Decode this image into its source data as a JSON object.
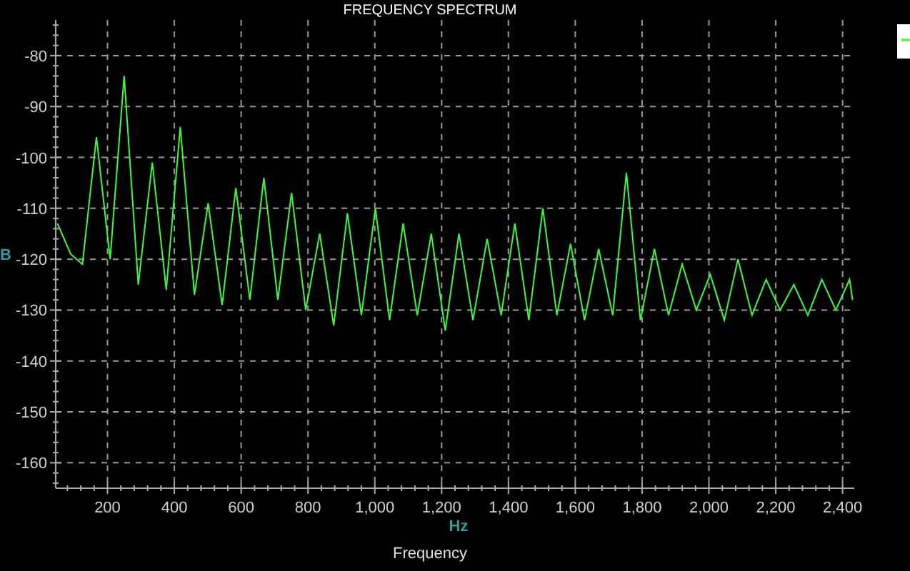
{
  "chart": {
    "chart_data": {
      "type": "line",
      "title": "FREQUENCY SPECTRUM",
      "xlabel": "Hz",
      "ylabel": "B",
      "x": [
        50,
        90,
        125,
        167,
        208,
        250,
        292,
        334,
        376,
        418,
        460,
        501,
        543,
        584,
        626,
        668,
        710,
        751,
        793,
        835,
        877,
        918,
        960,
        1002,
        1044,
        1085,
        1127,
        1169,
        1211,
        1252,
        1294,
        1336,
        1378,
        1419,
        1461,
        1503,
        1545,
        1586,
        1628,
        1670,
        1712,
        1753,
        1795,
        1837,
        1879,
        1920,
        1962,
        2004,
        2046,
        2087,
        2129,
        2171,
        2213,
        2254,
        2296,
        2338,
        2380,
        2421,
        2430
      ],
      "grid": true,
      "series": [
        {
          "color": "#33ff33",
          "values": [
            -113,
            -119,
            -121,
            -96,
            -120,
            -84,
            -125,
            -101,
            -126,
            -94,
            -127,
            -109,
            -129,
            -106,
            -128,
            -104,
            -128,
            -107,
            -130,
            -115,
            -133,
            -111,
            -131,
            -110,
            -132,
            -113,
            -131,
            -115,
            -134,
            -115,
            -132,
            -116,
            -131,
            -113,
            -132,
            -110,
            -131,
            -117,
            -132,
            -118,
            -131,
            -103,
            -132,
            -118,
            -131,
            -121,
            -130,
            -123,
            -132,
            -120,
            -131,
            -124,
            -130,
            -125,
            -131,
            -124,
            -130,
            -124,
            -128
          ]
        }
      ],
      "xlim": [
        45,
        2435
      ],
      "ylim": [
        -165,
        -73
      ],
      "xticks": [
        {
          "value": 200,
          "label": "200"
        },
        {
          "value": 400,
          "label": "400"
        },
        {
          "value": 600,
          "label": "600"
        },
        {
          "value": 800,
          "label": "800"
        },
        {
          "value": 1000,
          "label": "1,000"
        },
        {
          "value": 1200,
          "label": "1,200"
        },
        {
          "value": 1400,
          "label": "1,400"
        },
        {
          "value": 1600,
          "label": "1,600"
        },
        {
          "value": 1800,
          "label": "1,800"
        },
        {
          "value": 2000,
          "label": "2,000"
        },
        {
          "value": 2200,
          "label": "2,200"
        },
        {
          "value": 2400,
          "label": "2,400"
        }
      ],
      "yticks": [
        -160,
        -150,
        -140,
        -130,
        -120,
        -110,
        -100,
        -90,
        -80
      ]
    },
    "axis_caption": "Frequency"
  }
}
